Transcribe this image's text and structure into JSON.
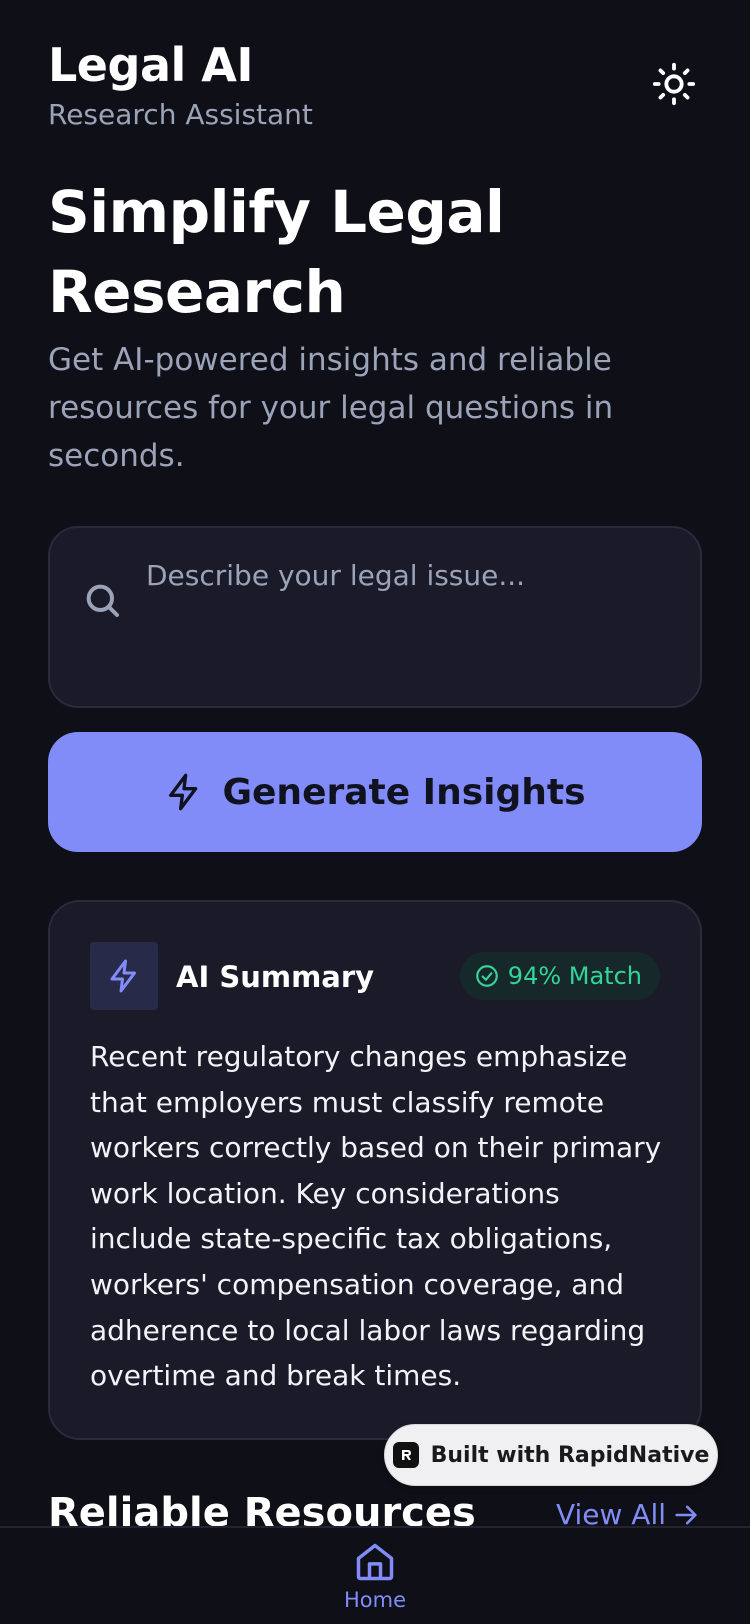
{
  "header": {
    "app_title": "Legal AI",
    "app_subtitle": "Research Assistant",
    "theme_toggle_icon": "sun-icon"
  },
  "hero": {
    "title": "Simplify Legal Research",
    "description": "Get AI-powered insights and reliable resources for your legal questions in seconds."
  },
  "search": {
    "placeholder": "Describe your legal issue...",
    "value": "",
    "icon": "search-icon"
  },
  "generate_button": {
    "label": "Generate Insights",
    "icon": "lightning-icon"
  },
  "summary": {
    "title": "AI Summary",
    "icon": "lightning-icon",
    "match_badge": "94% Match",
    "match_icon": "check-circle-icon",
    "text": "Recent regulatory changes emphasize that employers must classify remote workers correctly based on their primary work location. Key considerations include state-specific tax obligations, workers' compensation coverage, and adherence to local labor laws regarding overtime and break times."
  },
  "resources": {
    "title": "Reliable Resources",
    "view_all_label": "View All",
    "view_all_icon": "arrow-right-icon"
  },
  "badge": {
    "label": "Built with RapidNative"
  },
  "bottom_nav": {
    "items": [
      {
        "label": "Home",
        "icon": "home-icon",
        "active": true
      }
    ]
  },
  "colors": {
    "background": "#0f0f17",
    "card": "#1a1a29",
    "accent": "#818cf8",
    "muted_text": "#9aa3b8",
    "success": "#34d399"
  }
}
